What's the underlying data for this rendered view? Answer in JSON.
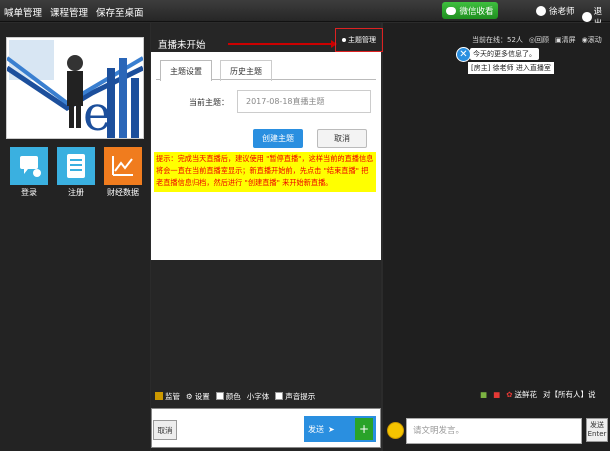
{
  "topbar": {
    "menu": [
      "喊单管理",
      "课程管理",
      "保存至桌面"
    ],
    "wechat_label": "微信收看",
    "user_name": "徐老师",
    "logout_label": "退出"
  },
  "left": {
    "tiles": [
      {
        "label": "登录",
        "icon": "chat-icon",
        "color": "#3ab0e0"
      },
      {
        "label": "注册",
        "icon": "list-icon",
        "color": "#3ab0e0"
      },
      {
        "label": "财经数据",
        "icon": "chart-icon",
        "color": "#f07c1e"
      }
    ]
  },
  "center": {
    "live_status": "直播未开始",
    "theme_manage": "主题管理"
  },
  "right": {
    "online_label": "当前在线：",
    "online_count": "52人",
    "review": "回顾",
    "clear": "清屏",
    "scroll": "滚动",
    "messages": [
      "今天的更多信息了。",
      "[房主] 徐老师 进入直播室"
    ]
  },
  "modal": {
    "tabs": [
      "主题设置",
      "历史主题"
    ],
    "current_label": "当前主题：",
    "current_placeholder": "2017-08-18直播主题",
    "create_label": "创建主题",
    "cancel_label": "取消",
    "tip": "提示：完成当天直播后，建议使用 \"暂停直播\"，这样当前的直播信息将会一直在当前直播室显示；新直播开始前，先点击 \"结束直播\" 把老直播信息归档，然后进行 \"创建直播\" 来开始新直播。"
  },
  "toolbar": {
    "monitor": "监管",
    "settings": "设置",
    "color": "颜色",
    "small_font": "小字体",
    "sound": "声音提示"
  },
  "compose": {
    "cancel_label": "取消",
    "send_label": "发送"
  },
  "right_bottom": {
    "flowers": "送鲜花",
    "to_label": "对【所有人】说",
    "input_placeholder": "请文明发言。",
    "send_label": "发送",
    "enter_label": "Enter"
  },
  "colors": {
    "accent": "#2a8fe0",
    "tip_bg": "#ffff00",
    "tip_text": "#e00000",
    "wechat": "#2fa82f"
  }
}
